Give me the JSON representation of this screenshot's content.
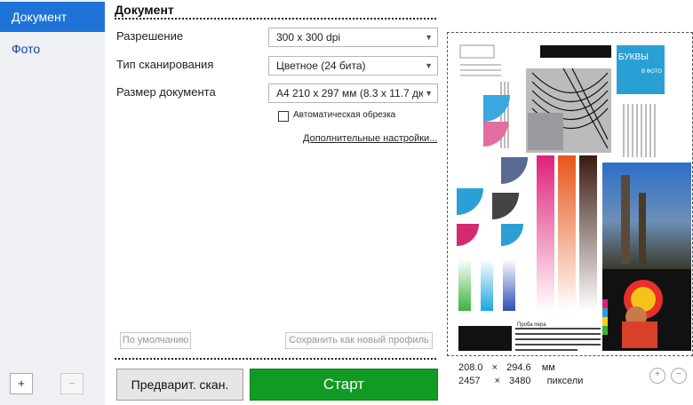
{
  "sidebar": {
    "items": [
      {
        "label": "Документ",
        "active": true
      },
      {
        "label": "Фото",
        "active": false
      }
    ],
    "add_label": "+",
    "remove_label": "−"
  },
  "section": {
    "title": "Документ"
  },
  "settings": {
    "resolution": {
      "label": "Разрешение",
      "value": "300 x 300 dpi"
    },
    "scan_type": {
      "label": "Тип сканирования",
      "value": "Цветное (24 бита)"
    },
    "doc_size": {
      "label": "Размер документа",
      "value": "A4 210 x 297 мм (8.3 x 11.7 дюй…"
    },
    "auto_crop": {
      "label": "Автоматическая обрезка",
      "checked": false
    },
    "advanced_link": "Дополнительные настройки..."
  },
  "buttons": {
    "defaults": "По умолчанию",
    "save_profile": "Сохранить как новый профиль",
    "preview": "Предварит. скан.",
    "start": "Старт"
  },
  "preview": {
    "badge_text": "БУКВЫ",
    "badge_sub": "В ФОТО",
    "caption": "Проба пера",
    "dims": {
      "mm_w": "208.0",
      "mm_h": "294.6",
      "mm_unit": "мм",
      "px_w": "2457",
      "px_h": "3480",
      "px_unit": "пиксели",
      "sep": "×"
    }
  },
  "colors": {
    "accent": "#1e73d8",
    "start": "#119b24"
  }
}
